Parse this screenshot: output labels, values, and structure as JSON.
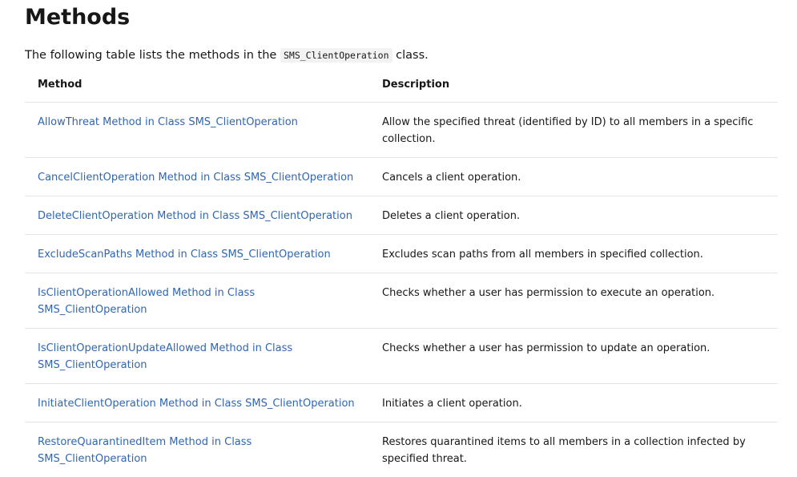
{
  "heading": "Methods",
  "intro": {
    "before": "The following table lists the methods in the ",
    "code": "SMS_ClientOperation",
    "after": " class."
  },
  "table": {
    "headers": {
      "method": "Method",
      "description": "Description"
    },
    "rows": [
      {
        "method": "AllowThreat Method in Class SMS_ClientOperation",
        "description": "Allow the specified threat (identified by ID) to all members in a specific collection."
      },
      {
        "method": "CancelClientOperation Method in Class SMS_ClientOperation",
        "description": "Cancels a client operation."
      },
      {
        "method": "DeleteClientOperation Method in Class SMS_ClientOperation",
        "description": "Deletes a client operation."
      },
      {
        "method": "ExcludeScanPaths Method in Class SMS_ClientOperation",
        "description": "Excludes scan paths from all members in specified collection."
      },
      {
        "method": "IsClientOperationAllowed Method in Class SMS_ClientOperation",
        "description": "Checks whether a user has permission to execute an operation."
      },
      {
        "method": "IsClientOperationUpdateAllowed Method in Class SMS_ClientOperation",
        "description": "Checks whether a user has permission to update an operation."
      },
      {
        "method": "InitiateClientOperation Method in Class SMS_ClientOperation",
        "description": "Initiates a client operation."
      },
      {
        "method": "RestoreQuarantinedItem Method in Class SMS_ClientOperation",
        "description": "Restores quarantined items to all members in a collection infected by specified threat."
      }
    ]
  },
  "colors": {
    "link": "#2f66b3",
    "text": "#171717",
    "border": "#e3e3e3",
    "code_bg": "#f2f2f2"
  }
}
